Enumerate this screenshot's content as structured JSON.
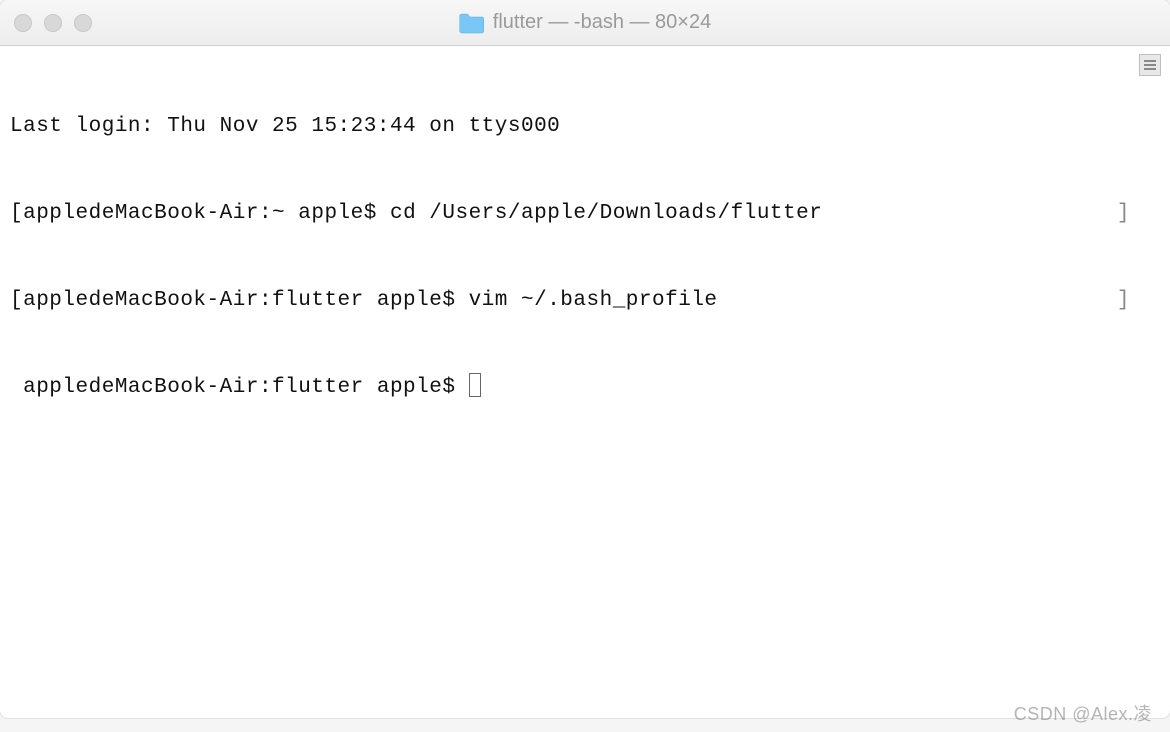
{
  "titlebar": {
    "title": "flutter — -bash — 80×24"
  },
  "terminal": {
    "last_login": "Last login: Thu Nov 25 15:23:44 on ttys000",
    "line1_prompt": "[appledeMacBook-Air:~ apple$ ",
    "line1_cmd": "cd /Users/apple/Downloads/flutter",
    "line1_end": "]",
    "line2_prompt": "[appledeMacBook-Air:flutter apple$ ",
    "line2_cmd": "vim ~/.bash_profile",
    "line2_end": "]",
    "line3_prompt": " appledeMacBook-Air:flutter apple$ "
  },
  "watermark": "CSDN @Alex.凌"
}
